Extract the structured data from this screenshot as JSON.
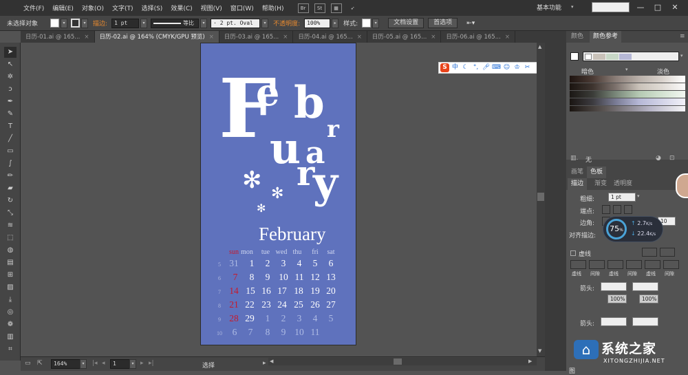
{
  "menubar": {
    "items": [
      "文件(F)",
      "编辑(E)",
      "对象(O)",
      "文字(T)",
      "选择(S)",
      "效果(C)",
      "视图(V)",
      "窗口(W)",
      "帮助(H)"
    ],
    "app_icons": [
      "Br",
      "St"
    ],
    "workspace": "基本功能",
    "window_min": "—",
    "window_max": "□",
    "window_close": "✕"
  },
  "control": {
    "selection": "未选择对象",
    "stroke_label": "描边:",
    "stroke_value": "1 pt",
    "line_style": "等比",
    "brush": "· 2 pt. Oval",
    "opacity_label": "不透明度:",
    "opacity_value": "100%",
    "style_label": "样式:",
    "doc_setup": "文档设置",
    "prefs": "首选项"
  },
  "tabs": [
    {
      "label": "日历-01.ai @ 165...",
      "active": false
    },
    {
      "label": "日历-02.ai @ 164% (CMYK/GPU 预览)",
      "active": true
    },
    {
      "label": "日历-03.ai @ 165...",
      "active": false
    },
    {
      "label": "日历-04.ai @ 165...",
      "active": false
    },
    {
      "label": "日历-05.ai @ 165...",
      "active": false
    },
    {
      "label": "日历-06.ai @ 165...",
      "active": false
    }
  ],
  "artboard": {
    "letters": {
      "f": "F",
      "e": "e",
      "b": "b",
      "r": "r",
      "u": "u",
      "a": "a",
      "r2": "r",
      "y": "y"
    },
    "flower": "✻",
    "month": "February",
    "days": [
      "sun",
      "mon",
      "tue",
      "wed",
      "thu",
      "fri",
      "sat"
    ],
    "weeks": [
      {
        "num": "5",
        "days": [
          "",
          "31",
          "1",
          "2",
          "3",
          "4",
          "5",
          "6"
        ]
      },
      {
        "num": "6",
        "days": [
          "",
          "7",
          "8",
          "9",
          "10",
          "11",
          "12",
          "13"
        ]
      },
      {
        "num": "7",
        "days": [
          "",
          "14",
          "15",
          "16",
          "17",
          "18",
          "19",
          "20"
        ]
      },
      {
        "num": "8",
        "days": [
          "",
          "21",
          "22",
          "23",
          "24",
          "25",
          "26",
          "27"
        ]
      },
      {
        "num": "9",
        "days": [
          "",
          "28",
          "29",
          "1",
          "2",
          "3",
          "4",
          "5"
        ]
      },
      {
        "num": "10",
        "days": [
          "",
          "",
          "6",
          "7",
          "8",
          "9",
          "10",
          "11"
        ]
      }
    ]
  },
  "ime": {
    "logo": "S",
    "lang": "中"
  },
  "status": {
    "zoom": "164%",
    "page": "1",
    "tool": "选择"
  },
  "panels": {
    "color_tab": "颜色",
    "swatch_tab": "颜色参考",
    "dark_label": "暗色",
    "light_label": "淡色",
    "none_label": "无",
    "brush_tab": "画笔",
    "swatches_tab": "色板",
    "stroke_tab": "描边",
    "gradient_tab": "渐变",
    "transparency_tab": "透明度",
    "weight_label": "粗细:",
    "weight_value": "1 pt",
    "cap_label": "端点:",
    "corner_label": "边角:",
    "limit_value": "10",
    "align_label": "对齐描边:",
    "dashed_label": "虚线",
    "dash_labels": [
      "虚线",
      "间隙",
      "虚线",
      "间隙",
      "虚线",
      "间隙"
    ],
    "arrow_label": "箭头:",
    "scale_value": "100%",
    "scale_value2": "100%",
    "graph_label": "图"
  },
  "speed": {
    "percent": "75",
    "unit": "%",
    "up": "2.7",
    "down": "22.4",
    "rate_unit": "K/s"
  },
  "watermark": {
    "brand": "系统之家",
    "url": "XITONGZHIJIA.NET"
  },
  "colors": {
    "artboard": "#5f72bd",
    "canvas": "#535353",
    "accent_red": "#c8182a"
  }
}
